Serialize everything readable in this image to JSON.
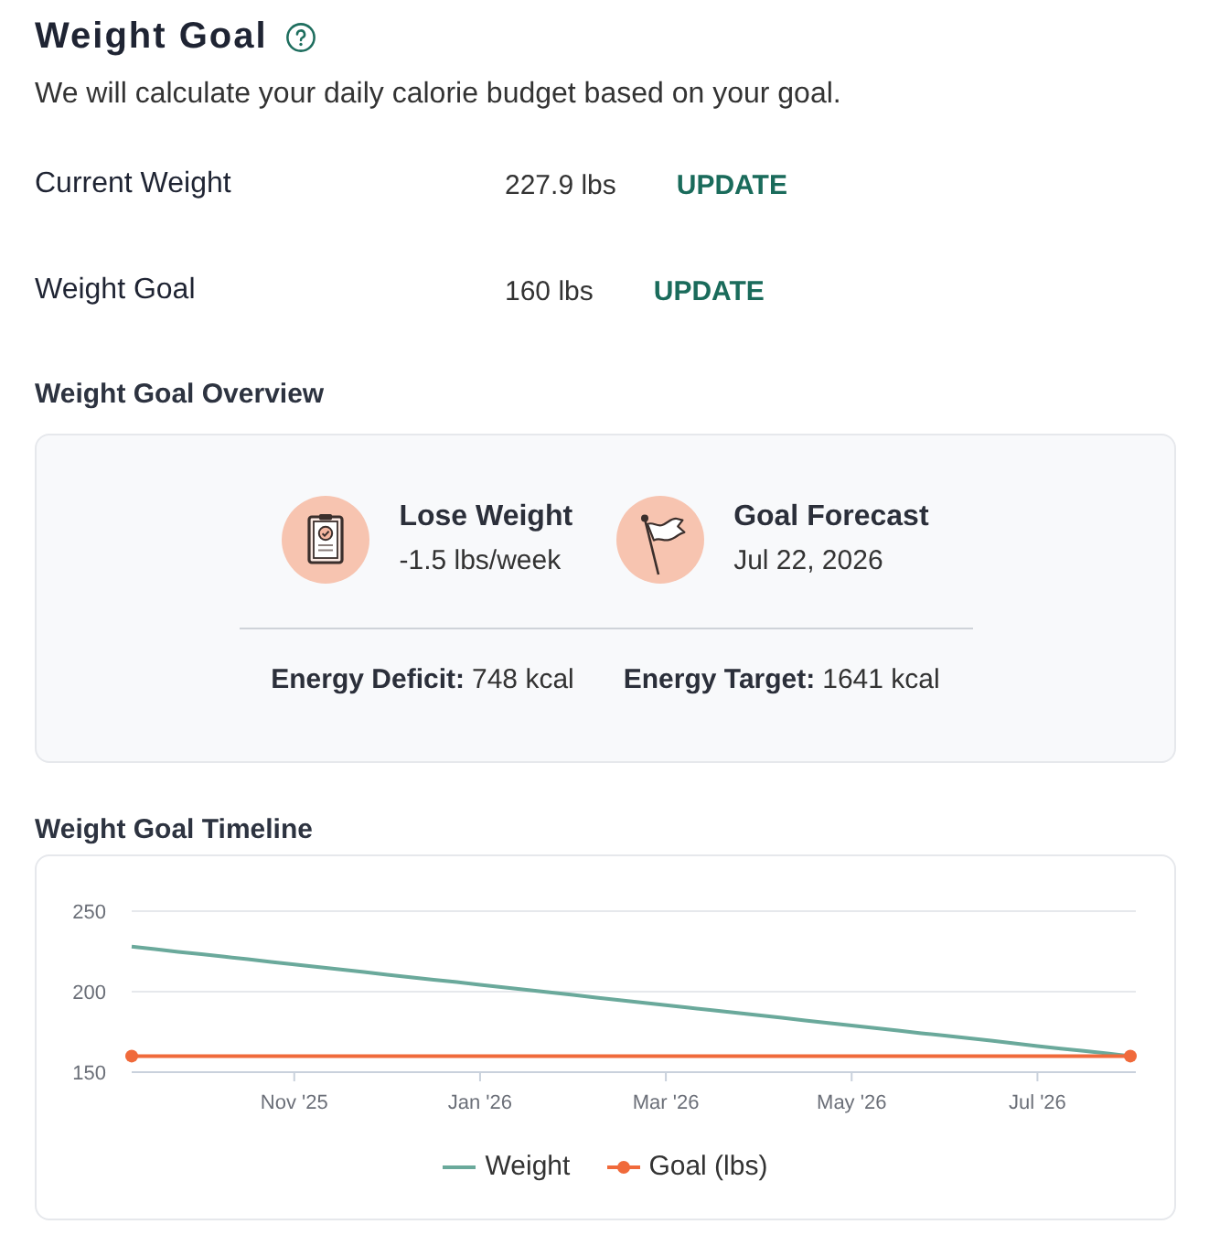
{
  "header": {
    "title": "Weight Goal",
    "subtitle": "We will calculate your daily calorie budget based on your goal."
  },
  "weights": [
    {
      "label": "Current Weight",
      "value": "227.9 lbs",
      "action": "UPDATE"
    },
    {
      "label": "Weight Goal",
      "value": "160 lbs",
      "action": "UPDATE"
    }
  ],
  "overview": {
    "title": "Weight Goal Overview",
    "stats": [
      {
        "kind": "plan",
        "title": "Lose Weight",
        "value": "-1.5 lbs/week"
      },
      {
        "kind": "forecast",
        "title": "Goal Forecast",
        "value": "Jul 22, 2026"
      }
    ],
    "energy": [
      {
        "label": "Energy Deficit:",
        "value": "748 kcal"
      },
      {
        "label": "Energy Target:",
        "value": "1641 kcal"
      }
    ]
  },
  "timeline": {
    "title": "Weight Goal Timeline",
    "chart_data": {
      "type": "line",
      "categories": [
        null,
        null,
        null,
        null,
        null,
        null,
        null,
        "Nov '25",
        null,
        null,
        null,
        null,
        null,
        null,
        null,
        "Jan '26",
        null,
        null,
        null,
        null,
        null,
        null,
        null,
        "Mar '26",
        null,
        null,
        null,
        null,
        null,
        null,
        null,
        "May '26",
        null,
        null,
        null,
        null,
        null,
        null,
        null,
        "Jul '26",
        null,
        null,
        null,
        null
      ],
      "series": [
        {
          "name": "Weight",
          "color": "#6aa99b",
          "values": [
            228.0,
            226.4,
            224.8,
            223.3,
            221.7,
            220.1,
            218.5,
            216.9,
            215.3,
            213.8,
            212.2,
            210.6,
            209.0,
            207.4,
            205.9,
            204.3,
            202.7,
            201.1,
            199.5,
            198.0,
            196.4,
            194.8,
            193.2,
            191.6,
            190.0,
            188.5,
            186.9,
            185.3,
            183.7,
            182.1,
            180.6,
            179.0,
            177.4,
            175.8,
            174.2,
            172.7,
            171.1,
            169.5,
            167.9,
            166.3,
            164.7,
            163.2,
            161.6,
            160.0
          ]
        },
        {
          "name": "Goal (lbs)",
          "color": "#f06a3b",
          "values": [
            160,
            160,
            160,
            160,
            160,
            160,
            160,
            160,
            160,
            160,
            160,
            160,
            160,
            160,
            160,
            160,
            160,
            160,
            160,
            160,
            160,
            160,
            160,
            160,
            160,
            160,
            160,
            160,
            160,
            160,
            160,
            160,
            160,
            160,
            160,
            160,
            160,
            160,
            160,
            160,
            160,
            160,
            160,
            160
          ]
        }
      ],
      "ylim": [
        150,
        250
      ],
      "yticks": [
        150,
        200,
        250
      ]
    }
  }
}
